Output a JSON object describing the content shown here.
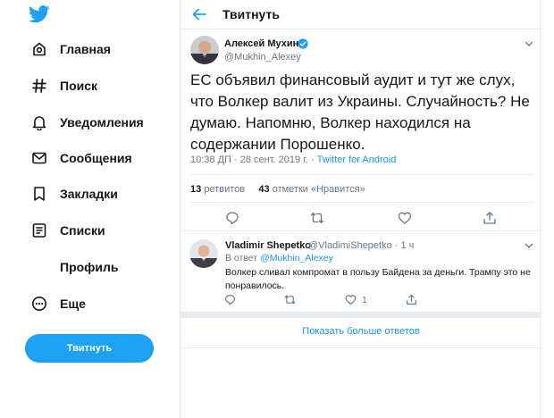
{
  "sidebar": {
    "logo": "twitter-bird-icon",
    "items": [
      {
        "label": "Главная",
        "icon": "home-icon"
      },
      {
        "label": "Поиск",
        "icon": "hashtag-icon"
      },
      {
        "label": "Уведомления",
        "icon": "bell-icon"
      },
      {
        "label": "Сообщения",
        "icon": "envelope-icon"
      },
      {
        "label": "Закладки",
        "icon": "bookmark-icon"
      },
      {
        "label": "Списки",
        "icon": "list-icon"
      },
      {
        "label": "Профиль",
        "icon": "profile-icon"
      },
      {
        "label": "Еще",
        "icon": "more-icon"
      }
    ],
    "tweet_button": "Твитнуть"
  },
  "header": {
    "title": "Твитнуть"
  },
  "tweet": {
    "author_name": "Алексей Мухин",
    "author_handle": "@Mukhin_Alexey",
    "text": "ЕС объявил финансовый аудит и тут же слух, что Волкер валит из Украины. Случайность? Не думаю. Напомню, Волкер находился на содержании Порошенко.",
    "time": "10:38 ДП · 28 сент. 2019 г. · ",
    "source": "Twitter for Android",
    "retweets_count": "13",
    "retweets_label": "ретвитов",
    "likes_count": "43",
    "likes_label": "отметки «Нравится»"
  },
  "reply": {
    "author_name": "Vladimir Shepetko",
    "author_handle": "@VladimiShepetko · 1 ч",
    "reply_to_prefix": "В ответ ",
    "reply_to_handle": "@Mukhin_Alexey",
    "text": "Волкер сливал компромат в пользу Байдена за деньги. Трампу это не понравилось.",
    "likes": "1"
  },
  "show_more": "Показать больше ответов",
  "colors": {
    "accent": "#1da1f2",
    "link": "#1b95e0",
    "secondary_text": "#657786",
    "border": "#e6ecf0"
  }
}
